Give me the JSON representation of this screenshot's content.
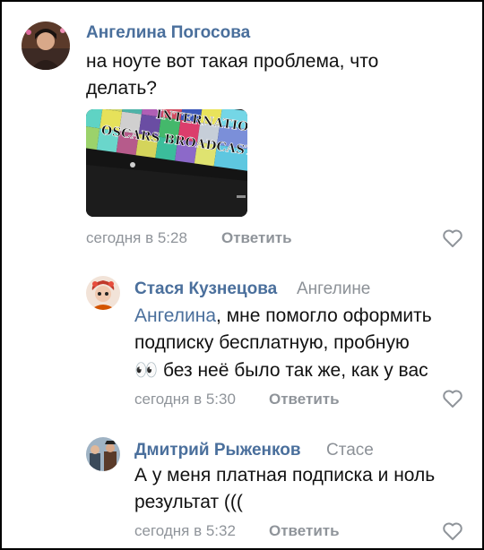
{
  "comments": [
    {
      "author": "Ангелина Погосова",
      "text_line1": "на ноуте вот такая проблема, что",
      "text_line2": "делать?",
      "attachment": {
        "line1": "INTERNATIONAL",
        "line2": "OSCARS BROADCAST"
      },
      "time": "сегодня в 5:28",
      "reply_label": "Ответить",
      "avatar_icon": "user-photo"
    },
    {
      "author": "Стася Кузнецова",
      "reply_to": "Ангелине",
      "mention": "Ангелина",
      "text_line1_rest": ", мне помогло оформить",
      "text_line2": "подписку бесплатную, пробную",
      "emoji": "👀",
      "text_line3": " без неё было так же, как у вас",
      "time": "сегодня в 5:30",
      "reply_label": "Ответить",
      "avatar_icon": "user-photo"
    },
    {
      "author": "Дмитрий Рыженков",
      "reply_to": "Стасе",
      "text_line1": "А у меня платная подписка и ноль",
      "text_line2": "результат (((",
      "time": "сегодня в 5:32",
      "reply_label": "Ответить",
      "avatar_icon": "user-photo"
    }
  ],
  "icons": {
    "like": "heart-outline-icon"
  },
  "colors": {
    "link": "#4a6f9c",
    "meta": "#8f949a",
    "text": "#111111"
  }
}
